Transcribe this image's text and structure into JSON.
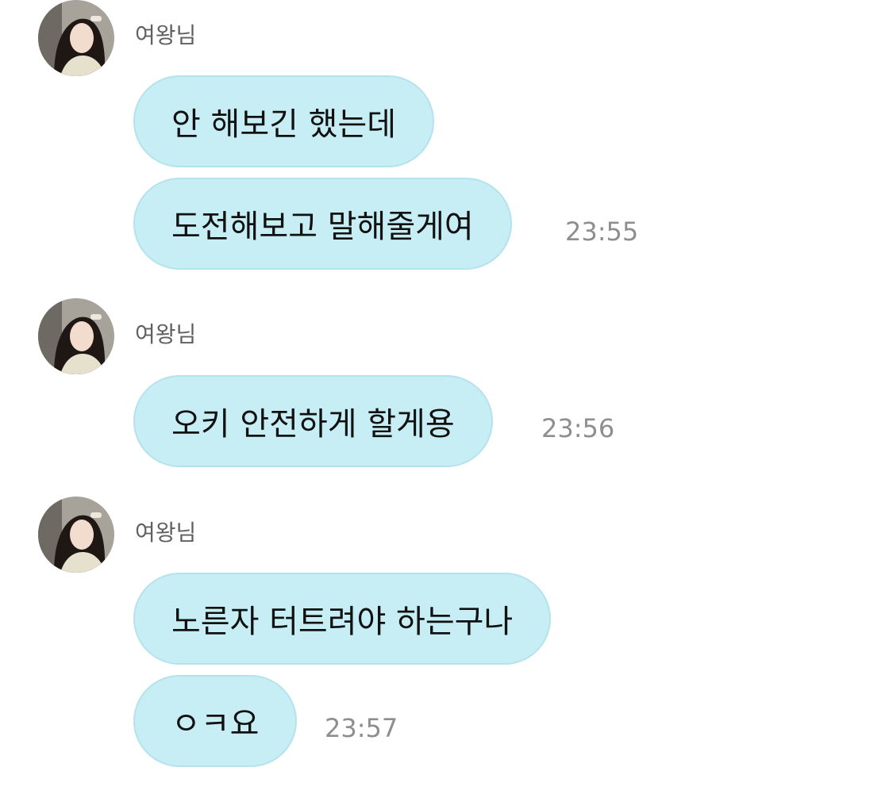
{
  "chat": {
    "groups": [
      {
        "sender": "여왕님",
        "avatar_icon": "profile-photo-avatar",
        "messages": [
          {
            "text": "안 해보긴 했는데",
            "time": ""
          },
          {
            "text": "도전해보고 말해줄게여",
            "time": "23:55"
          }
        ]
      },
      {
        "sender": "여왕님",
        "avatar_icon": "profile-photo-avatar",
        "messages": [
          {
            "text": "오키 안전하게 할게용",
            "time": "23:56"
          }
        ]
      },
      {
        "sender": "여왕님",
        "avatar_icon": "profile-photo-avatar",
        "messages": [
          {
            "text": "노른자 터트려야 하는구나",
            "time": ""
          },
          {
            "text": "ㅇㅋ요",
            "time": "23:57"
          }
        ]
      }
    ]
  },
  "colors": {
    "bubble": "#c6eef4",
    "bubble_border": "#b4e3ec",
    "time_text": "#8e8e8e",
    "sender_text": "#606060"
  }
}
